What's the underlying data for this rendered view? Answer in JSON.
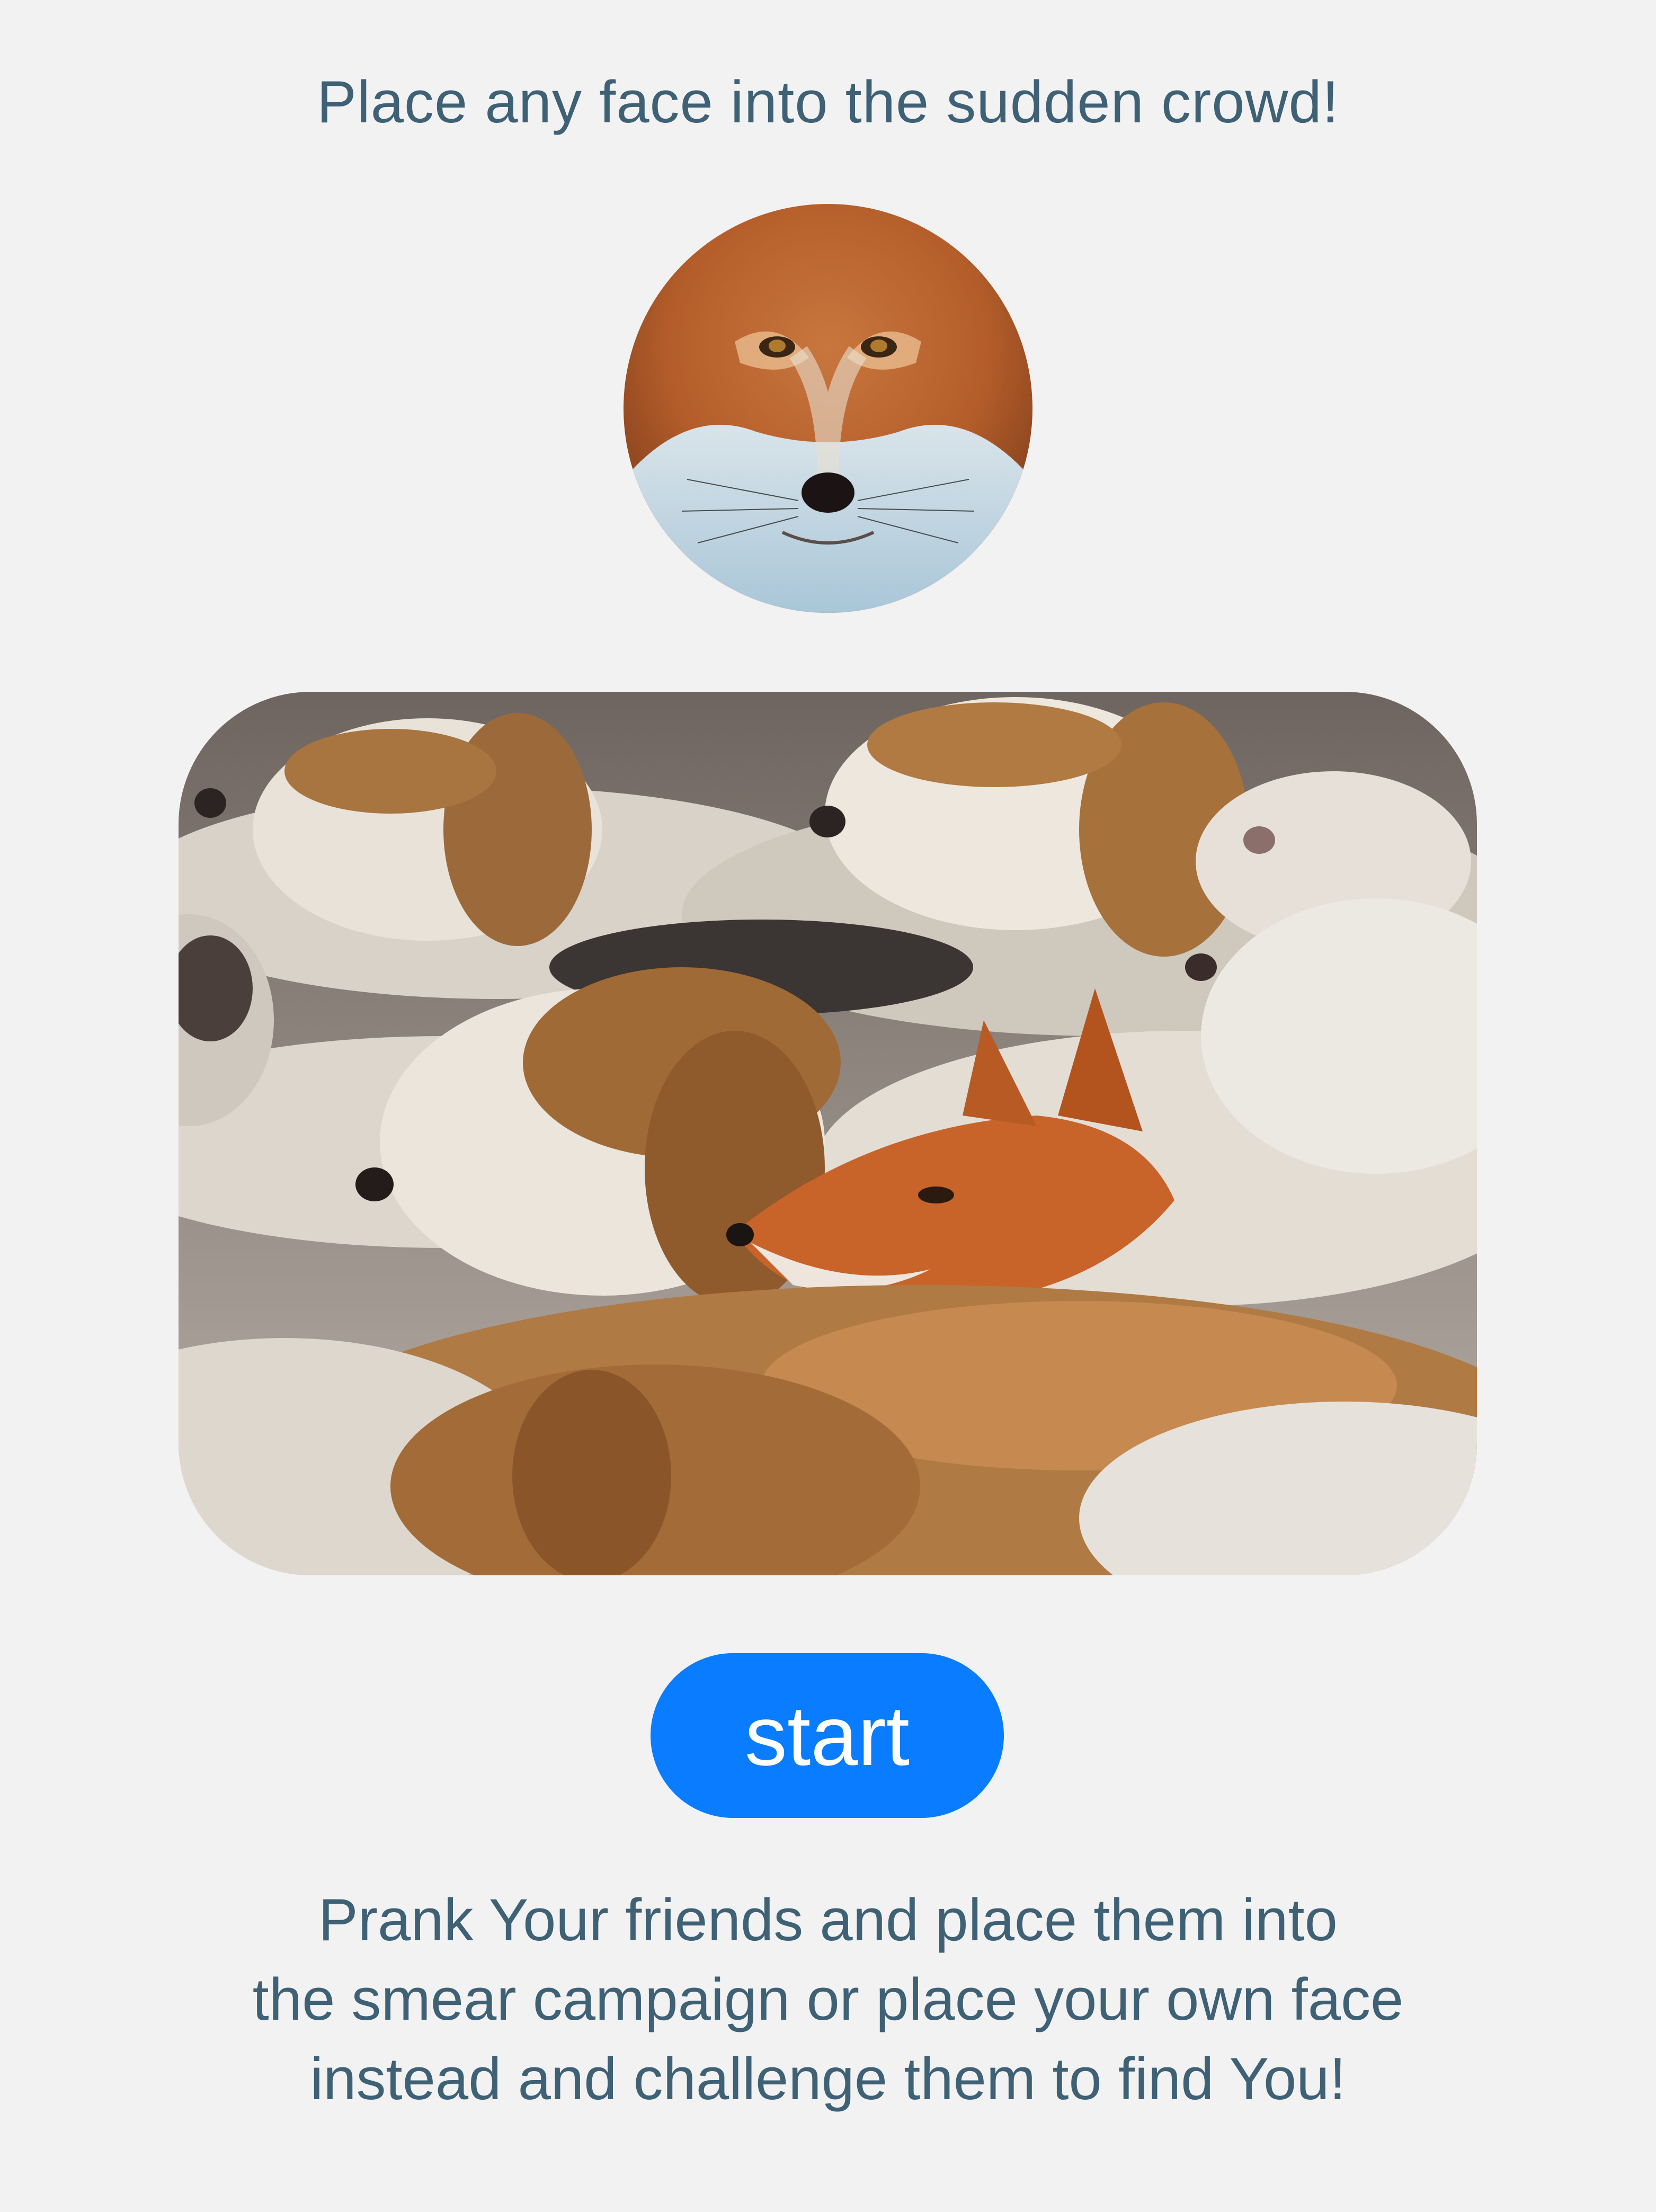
{
  "header": {
    "title": "Place any face into the sudden crowd!"
  },
  "face_preview": {
    "icon": "fox-face-photo"
  },
  "crowd_preview": {
    "icon": "hound-crowd-with-fox-photo"
  },
  "actions": {
    "start_label": "start"
  },
  "description": {
    "lines": [
      "Prank Your friends and place them into",
      "the smear campaign or place your own face",
      "instead and challenge them to find You!"
    ]
  },
  "colors": {
    "background": "#f2f2f2",
    "text": "#3f6175",
    "button": "#0a7cff",
    "button_text": "#ffffff"
  }
}
